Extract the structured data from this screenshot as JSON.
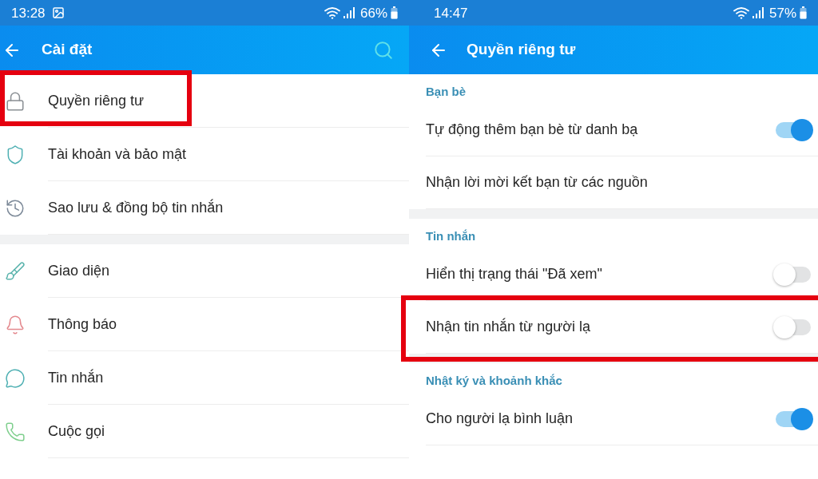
{
  "settings_screen": {
    "status_bar": {
      "time": "13:28",
      "notification_icon": true,
      "battery": "66%"
    },
    "app_bar": {
      "title": "Cài đặt",
      "search": true
    },
    "groups": [
      {
        "items": [
          {
            "label": "Quyền riêng tư",
            "highlighted": true
          },
          {
            "label": "Tài khoản và bảo mật",
            "highlighted": false
          },
          {
            "label": "Sao lưu & đồng bộ tin nhắn",
            "highlighted": false
          }
        ]
      },
      {
        "items": [
          {
            "label": "Giao diện",
            "highlighted": false
          },
          {
            "label": "Thông báo",
            "highlighted": false
          },
          {
            "label": "Tin nhắn",
            "highlighted": false
          },
          {
            "label": "Cuộc gọi",
            "highlighted": false
          }
        ]
      }
    ]
  },
  "privacy_screen": {
    "status_bar": {
      "time": "14:47",
      "battery": "57%"
    },
    "app_bar": {
      "title": "Quyền riêng tư"
    },
    "sections": [
      {
        "title": "Bạn bè",
        "items": [
          {
            "label": "Tự động thêm bạn bè từ danh bạ",
            "kind": "toggle",
            "on": true,
            "highlighted": false
          },
          {
            "label": "Nhận lời mời kết bạn từ các nguồn",
            "kind": "link",
            "highlighted": false
          }
        ]
      },
      {
        "title": "Tin nhắn",
        "items": [
          {
            "label": "Hiển thị trạng thái \"Đã xem\"",
            "kind": "toggle",
            "on": false,
            "highlighted": false
          },
          {
            "label": "Nhận tin nhắn từ người lạ",
            "kind": "toggle",
            "on": false,
            "highlighted": true
          }
        ]
      },
      {
        "title": "Nhật ký và khoảnh khắc",
        "items": [
          {
            "label": "Cho người lạ bình luận",
            "kind": "toggle",
            "on": true,
            "highlighted": false
          }
        ]
      }
    ]
  }
}
